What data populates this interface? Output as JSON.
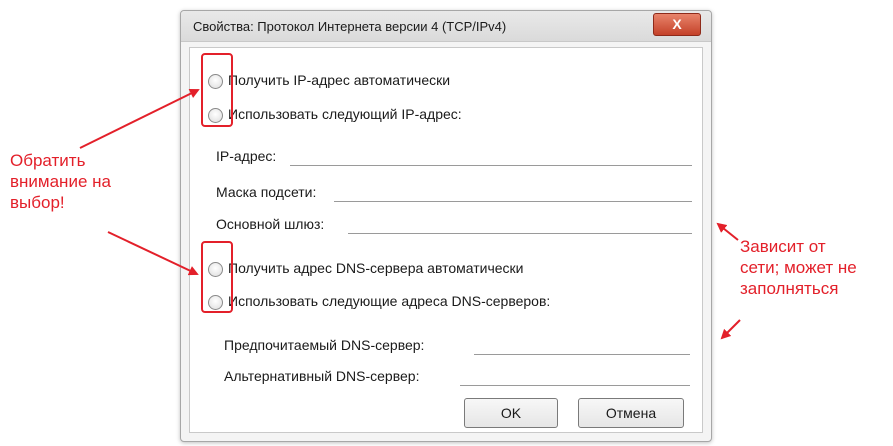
{
  "dialog": {
    "title": "Свойства: Протокол Интернета версии 4 (TCP/IPv4)",
    "close_label": "X",
    "radio_ip_auto": "Получить IP-адрес автоматически",
    "radio_ip_manual": "Использовать следующий IP-адрес:",
    "field_ip": "IP-адрес:",
    "field_mask": "Маска подсети:",
    "field_gateway": "Основной шлюз:",
    "radio_dns_auto": "Получить адрес DNS-сервера автоматически",
    "radio_dns_manual": "Использовать следующие адреса DNS-серверов:",
    "field_dns_pref": "Предпочитаемый DNS-сервер:",
    "field_dns_alt": "Альтернативный DNS-сервер:",
    "ok_label": "OK",
    "cancel_label": "Отмена"
  },
  "annotations": {
    "left_note": [
      "Обратить",
      "внимание на",
      "выбор!"
    ],
    "right_note": [
      "Зависит от",
      "сети; может не",
      "заполняться"
    ]
  },
  "colors": {
    "annotation": "#e3202a",
    "close_button": "#c44129"
  }
}
